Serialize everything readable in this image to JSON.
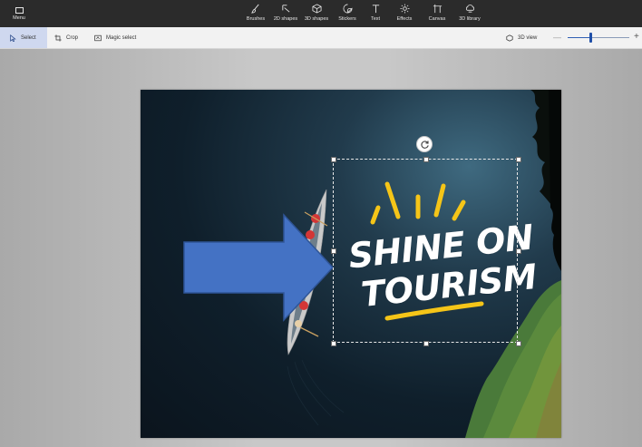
{
  "topbar": {
    "menu_label": "Menu",
    "tools": [
      {
        "label": "Brushes",
        "icon": "brush-icon"
      },
      {
        "label": "2D shapes",
        "icon": "2d-shapes-icon"
      },
      {
        "label": "3D shapes",
        "icon": "3d-shapes-icon"
      },
      {
        "label": "Stickers",
        "icon": "stickers-icon"
      },
      {
        "label": "Text",
        "icon": "text-icon"
      },
      {
        "label": "Effects",
        "icon": "effects-icon"
      },
      {
        "label": "Canvas",
        "icon": "canvas-icon"
      },
      {
        "label": "3D library",
        "icon": "3d-library-icon"
      }
    ]
  },
  "subbar": {
    "select_label": "Select",
    "crop_label": "Crop",
    "magic_select_label": "Magic select",
    "view3d_label": "3D view",
    "zoom_fraction": 0.38
  },
  "canvas": {
    "sticker_line1": "SHINE ON",
    "sticker_line2": "TOURISM",
    "colors": {
      "arrow_fill": "#4472c4",
      "arrow_stroke": "#2f5597",
      "sticker_accent": "#f5c518",
      "water_dark": "#0b141d",
      "foliage": "#4a7a3a"
    }
  }
}
